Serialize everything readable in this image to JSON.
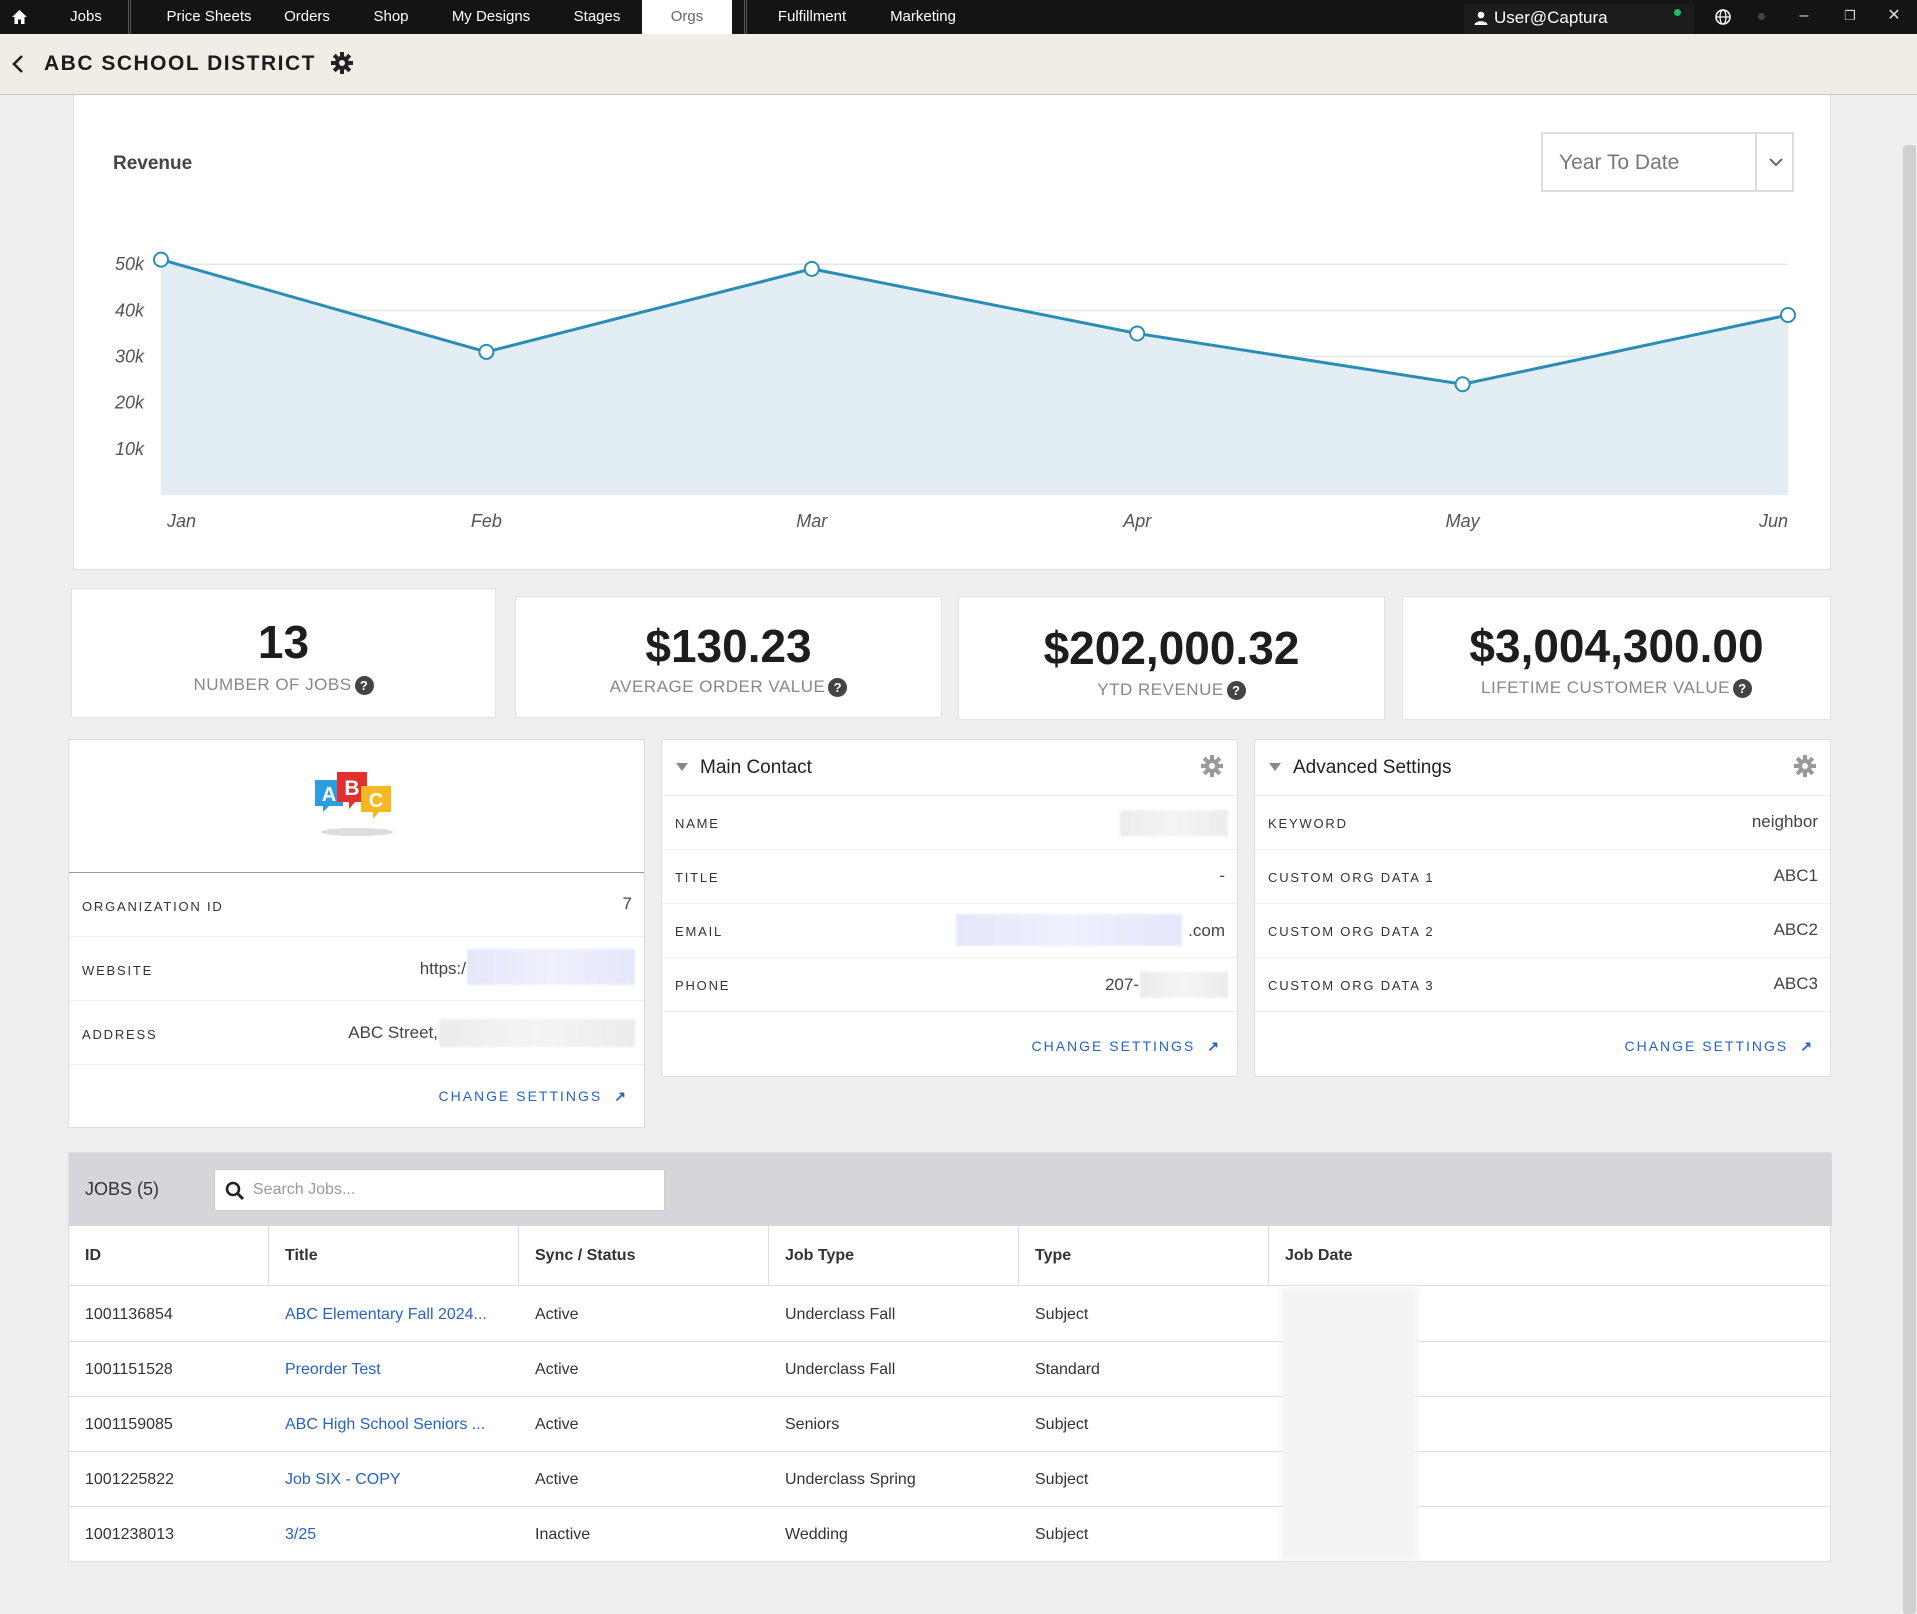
{
  "nav": {
    "items": [
      {
        "label": "Jobs"
      },
      {
        "label": "Price Sheets"
      },
      {
        "label": "Orders"
      },
      {
        "label": "Shop"
      },
      {
        "label": "My Designs"
      },
      {
        "label": "Stages"
      },
      {
        "label": "Orgs"
      },
      {
        "label": "Fulfillment"
      },
      {
        "label": "Marketing"
      }
    ],
    "active": "Orgs",
    "user": "User@Captura",
    "icons": [
      "home-icon",
      "user-icon",
      "globe-icon",
      "minimize-icon",
      "restore-icon",
      "close-icon"
    ]
  },
  "header": {
    "title": "ABC SCHOOL DISTRICT"
  },
  "revenue": {
    "title": "Revenue",
    "range": "Year To Date"
  },
  "chart_data": {
    "type": "area",
    "title": "Revenue",
    "categories": [
      "Jan",
      "Feb",
      "Mar",
      "Apr",
      "May",
      "Jun"
    ],
    "values": [
      51000,
      31000,
      49000,
      35000,
      24000,
      39000
    ],
    "y_ticks": [
      "10k",
      "20k",
      "30k",
      "40k",
      "50k"
    ],
    "ylim": [
      0,
      52000
    ],
    "grid": true,
    "line_color": "#2a8db5",
    "fill_color": "#e3edf4"
  },
  "kpis": [
    {
      "value": "13",
      "label": "NUMBER OF JOBS"
    },
    {
      "value": "$130.23",
      "label": "AVERAGE ORDER VALUE"
    },
    {
      "value": "$202,000.32",
      "label": "YTD REVENUE"
    },
    {
      "value": "$3,004,300.00",
      "label": "LIFETIME CUSTOMER VALUE"
    }
  ],
  "org": {
    "logo_letters": [
      "A",
      "B",
      "C"
    ],
    "rows": [
      {
        "label": "ORGANIZATION ID",
        "value": "7"
      },
      {
        "label": "WEBSITE",
        "value": "https:/"
      },
      {
        "label": "ADDRESS",
        "value": "ABC Street,"
      }
    ],
    "change_settings": "CHANGE SETTINGS"
  },
  "main_contact": {
    "title": "Main Contact",
    "rows": [
      {
        "label": "NAME",
        "value": ""
      },
      {
        "label": "TITLE",
        "value": "-"
      },
      {
        "label": "EMAIL",
        "value": ".com"
      },
      {
        "label": "PHONE",
        "value": "207-"
      }
    ],
    "change_settings": "CHANGE SETTINGS"
  },
  "advanced": {
    "title": "Advanced Settings",
    "rows": [
      {
        "label": "KEYWORD",
        "value": "neighbor"
      },
      {
        "label": "CUSTOM ORG DATA 1",
        "value": "ABC1"
      },
      {
        "label": "CUSTOM ORG DATA 2",
        "value": "ABC2"
      },
      {
        "label": "CUSTOM ORG DATA 3",
        "value": "ABC3"
      }
    ],
    "change_settings": "CHANGE SETTINGS"
  },
  "jobs": {
    "title": "JOBS (5)",
    "search_placeholder": "Search Jobs...",
    "columns": [
      "ID",
      "Title",
      "Sync / Status",
      "Job Type",
      "Type",
      "Job Date"
    ],
    "rows": [
      {
        "id": "1001136854",
        "title": "ABC Elementary Fall 2024...",
        "status": "Active",
        "job_type": "Underclass Fall",
        "type": "Subject"
      },
      {
        "id": "1001151528",
        "title": "Preorder Test",
        "status": "Active",
        "job_type": "Underclass Fall",
        "type": "Standard"
      },
      {
        "id": "1001159085",
        "title": "ABC High School Seniors ...",
        "status": "Active",
        "job_type": "Seniors",
        "type": "Subject"
      },
      {
        "id": "1001225822",
        "title": "Job SIX - COPY",
        "status": "Active",
        "job_type": "Underclass Spring",
        "type": "Subject"
      },
      {
        "id": "1001238013",
        "title": "3/25",
        "status": "Inactive",
        "job_type": "Wedding",
        "type": "Subject"
      }
    ]
  }
}
